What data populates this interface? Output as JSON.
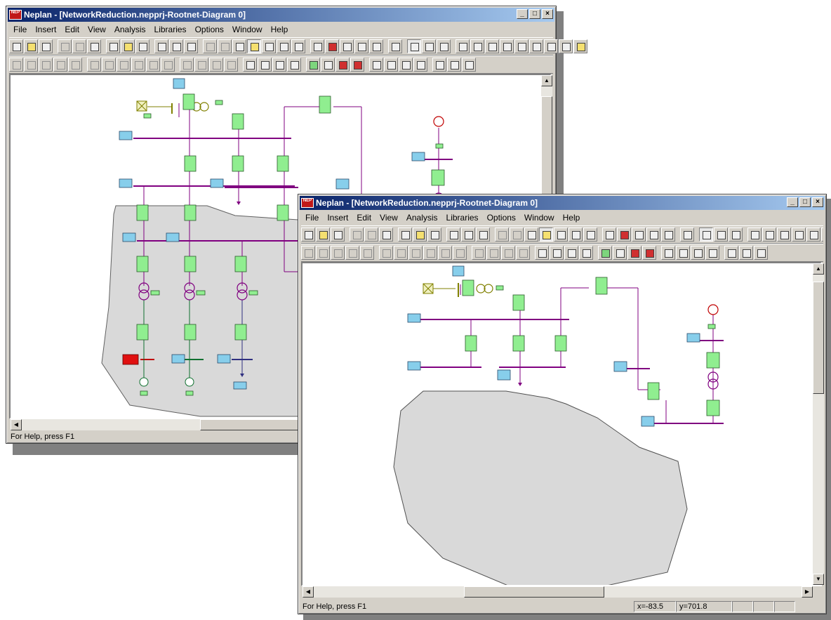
{
  "windows": [
    {
      "title": "Neplan - [NetworkReduction.nepprj-Rootnet-Diagram 0]",
      "menu": [
        "File",
        "Insert",
        "Edit",
        "View",
        "Analysis",
        "Libraries",
        "Options",
        "Window",
        "Help"
      ],
      "status_text": "For Help, press F1"
    },
    {
      "title": "Neplan - [NetworkReduction.nepprj-Rootnet-Diagram 0]",
      "menu": [
        "File",
        "Insert",
        "Edit",
        "View",
        "Analysis",
        "Libraries",
        "Options",
        "Window",
        "Help"
      ],
      "status_text": "For Help, press F1",
      "coord_x": "x=-83.5",
      "coord_y": "y=701.8"
    }
  ],
  "title_buttons": {
    "minimize": "_",
    "maximize": "□",
    "close": "×"
  },
  "colors": {
    "bus": "#800080",
    "element_box": "#90ee90",
    "label_box": "#87ceeb",
    "area_fill": "#d9d9d9",
    "alarm": "#e01010",
    "source": "#c00000"
  }
}
